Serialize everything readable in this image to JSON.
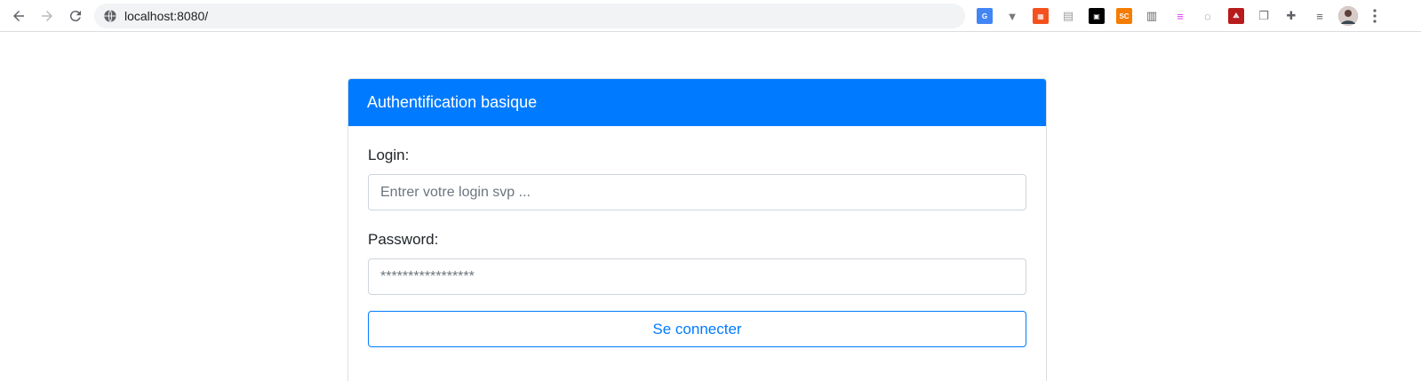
{
  "browser": {
    "url": "localhost:8080/",
    "extensions": [
      {
        "name": "google-translate-icon",
        "color": "#4285f4",
        "glyph": "G"
      },
      {
        "name": "vue-devtools-icon",
        "color": "#7a7a7a",
        "glyph": "▼"
      },
      {
        "name": "layout-extension-icon",
        "color": "#f4511e",
        "glyph": "▦"
      },
      {
        "name": "document-extension-icon",
        "color": "#9e9e9e",
        "glyph": "▤"
      },
      {
        "name": "contact-extension-icon",
        "color": "#000000",
        "glyph": "▣"
      },
      {
        "name": "sc-extension-icon",
        "color": "#f57c00",
        "glyph": "SC"
      },
      {
        "name": "notes-extension-icon",
        "color": "#5f6368",
        "glyph": "▥"
      },
      {
        "name": "highlight-extension-icon",
        "color": "#e040fb",
        "glyph": "≡"
      },
      {
        "name": "code-extension-icon",
        "color": "#5f6368",
        "glyph": "◌"
      },
      {
        "name": "pdf-extension-icon",
        "color": "#b71c1c",
        "glyph": "⟁"
      },
      {
        "name": "copy-extension-icon",
        "color": "#757575",
        "glyph": "❐"
      },
      {
        "name": "puzzle-icon",
        "color": "#5f6368",
        "glyph": "✚"
      },
      {
        "name": "media-queue-icon",
        "color": "#5f6368",
        "glyph": "≡"
      }
    ]
  },
  "card": {
    "header_title": "Authentification basique",
    "header_color": "#007bff",
    "login_label": "Login:",
    "login_placeholder": "Entrer votre login svp ...",
    "password_label": "Password:",
    "password_placeholder": "*****************",
    "submit_label": "Se connecter"
  }
}
